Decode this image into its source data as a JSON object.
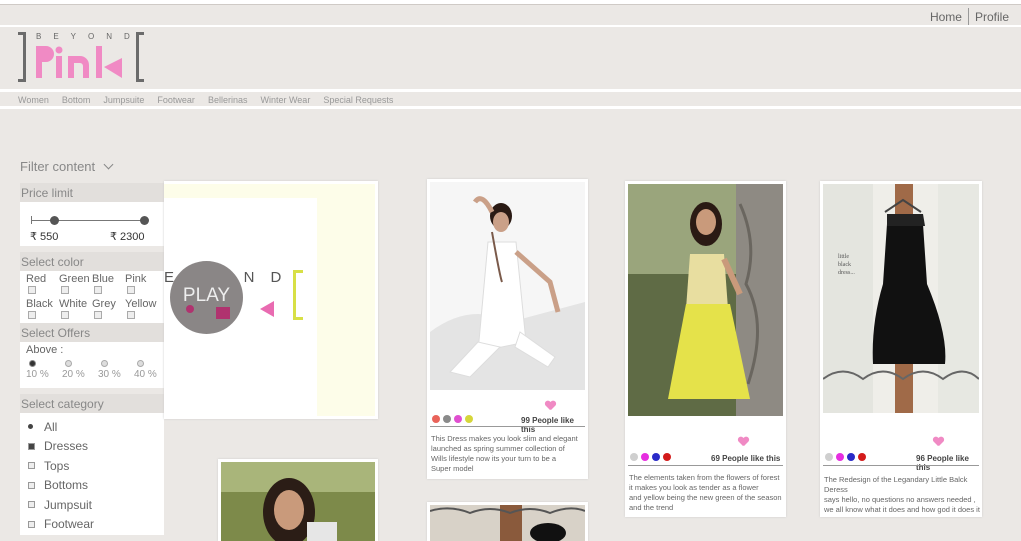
{
  "header": {
    "links": [
      "Home",
      "Profile"
    ],
    "logo": {
      "top_word": "BEYOND",
      "brand": "Pink"
    }
  },
  "nav": [
    "Women",
    "Bottom",
    "Jumpsuite",
    "Footwear",
    "Bellerinas",
    "Winter Wear",
    "Special Requests"
  ],
  "filter": {
    "title": "Filter content",
    "price": {
      "heading": "Price limit",
      "min": "₹ 550",
      "max": "₹ 2300"
    },
    "color": {
      "heading": "Select color",
      "options": [
        "Red",
        "Green",
        "Blue",
        "Pink",
        "Black",
        "White",
        "Grey",
        "Yellow"
      ]
    },
    "offers": {
      "heading": "Select Offers",
      "label": "Above :",
      "options": [
        "10 %",
        "20 %",
        "30 %",
        "40 %"
      ],
      "selected": "10 %"
    },
    "category": {
      "heading": "Select category",
      "options": [
        "All",
        "Dresses",
        "Tops",
        "Bottoms",
        "Jumpsuit",
        "Footwear"
      ],
      "checked": [
        "Dresses"
      ],
      "selected": "All"
    }
  },
  "video": {
    "word": "EYOND",
    "play": "PLAY"
  },
  "products": [
    {
      "swatches": [
        "#e9635a",
        "#8a8a8a",
        "#e04fd0",
        "#d6d63a"
      ],
      "likes": "99 People like this",
      "desc": [
        "This Dress makes you look slim and elegant",
        "launched as spring summer collection of",
        "Wills lifestyle now its your turn to be a",
        "Super model"
      ]
    },
    {
      "swatches": [
        "#cfcfcf",
        "#e62ee0",
        "#2a2ac8",
        "#d31b1b"
      ],
      "likes": "69 People like this",
      "desc": [
        "The elements taken from the flowers of forest",
        "it makes you look as tender as a flower",
        "and yellow being the new green of the season",
        "and the trend"
      ]
    },
    {
      "swatches": [
        "#cfcfcf",
        "#e62ee0",
        "#2a2ac8",
        "#d31b1b"
      ],
      "likes": "96 People like this",
      "desc": [
        "The Redesign of the Legandary Little Balck Deress",
        "says hello, no questions no answers needed ,",
        "we all know what it does and how god it does it"
      ]
    }
  ],
  "product3_caption": [
    "little",
    "black",
    "dress..."
  ],
  "colors": {
    "accent_pink": "#f08ac4",
    "background": "#ebe8e5",
    "logo_grey": "#6b6b6b"
  }
}
